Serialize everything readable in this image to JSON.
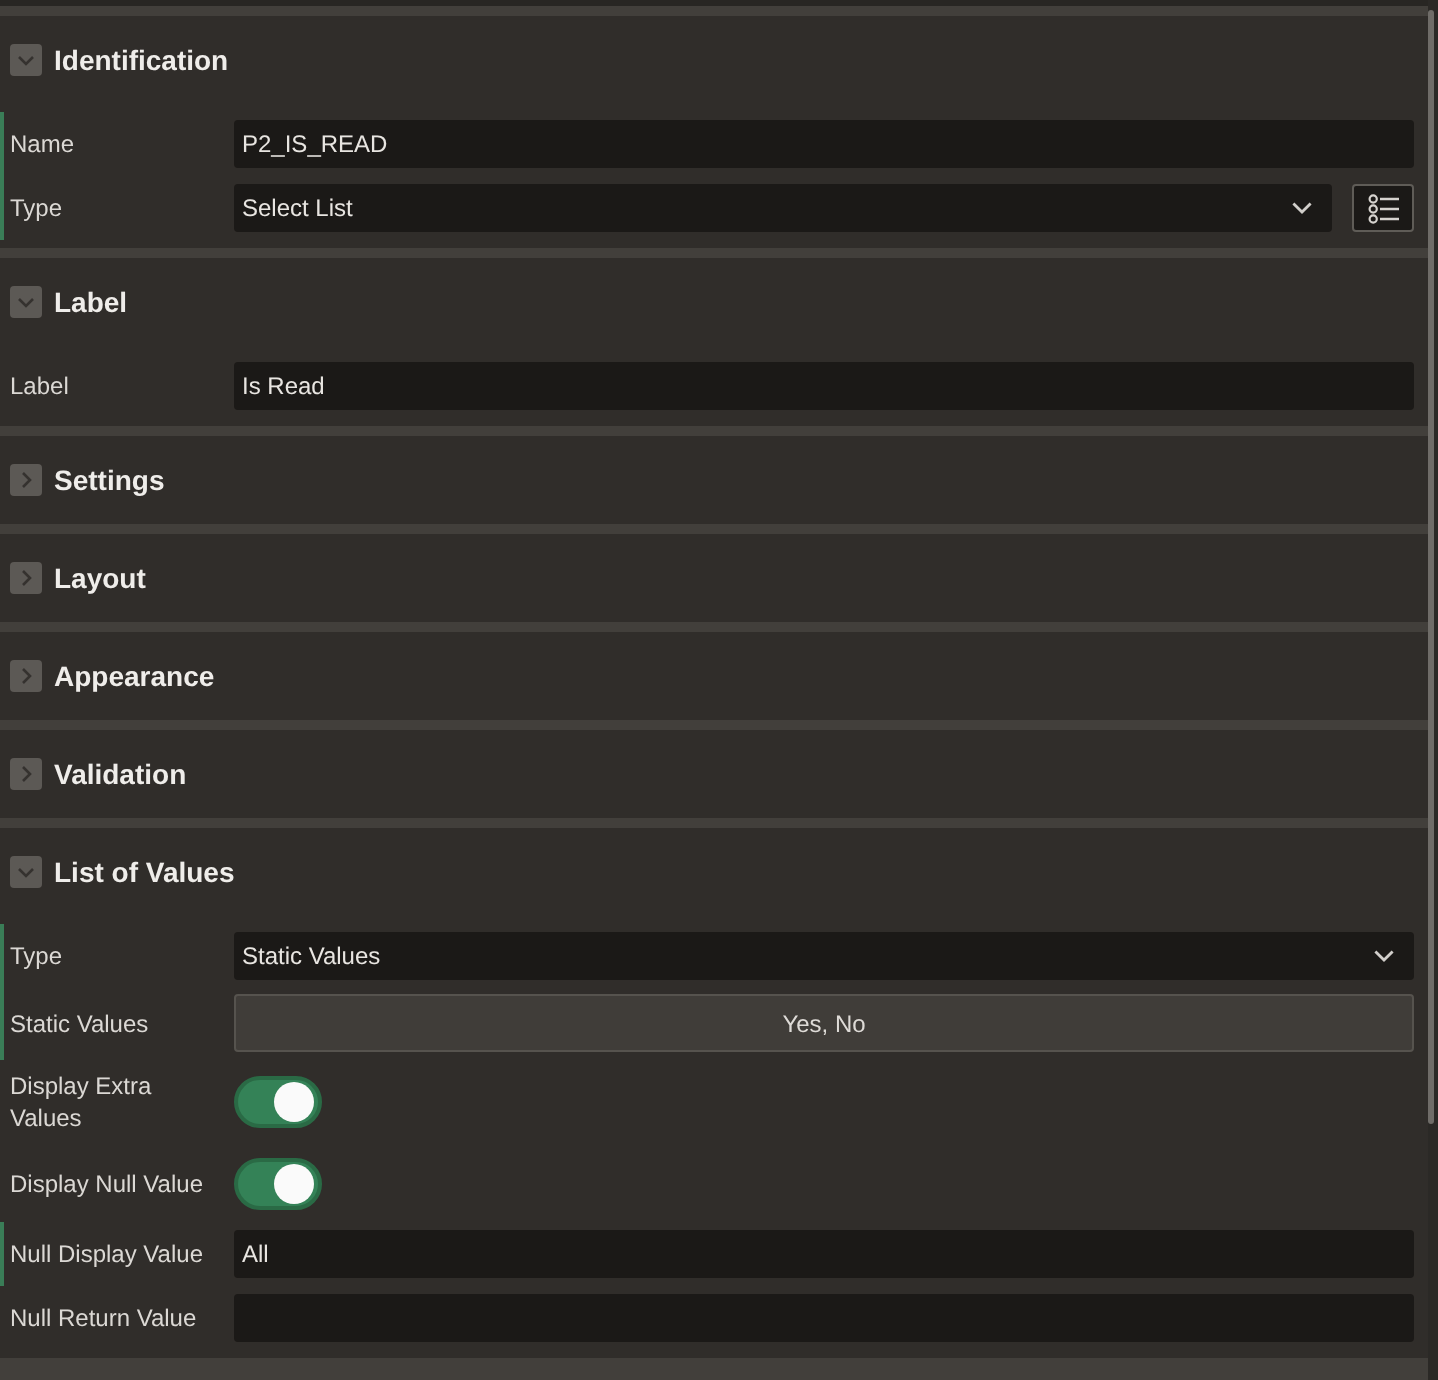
{
  "sections": [
    {
      "title": "Identification",
      "expanded": true,
      "rows": [
        {
          "kind": "text",
          "label": "Name",
          "required": true,
          "value": "P2_IS_READ"
        },
        {
          "kind": "select",
          "label": "Type",
          "required": true,
          "value": "Select List",
          "picker": true
        }
      ]
    },
    {
      "title": "Label",
      "expanded": true,
      "rows": [
        {
          "kind": "text",
          "label": "Label",
          "required": false,
          "value": "Is Read"
        }
      ]
    },
    {
      "title": "Settings",
      "expanded": false
    },
    {
      "title": "Layout",
      "expanded": false
    },
    {
      "title": "Appearance",
      "expanded": false
    },
    {
      "title": "Validation",
      "expanded": false
    },
    {
      "title": "List of Values",
      "expanded": true,
      "rows": [
        {
          "kind": "select",
          "label": "Type",
          "required": true,
          "value": "Static Values",
          "picker": false
        },
        {
          "kind": "button",
          "label": "Static Values",
          "required": true,
          "value": "Yes, No"
        },
        {
          "kind": "switch",
          "label": "Display Extra Values",
          "required": false,
          "on": true
        },
        {
          "kind": "switch",
          "label": "Display Null Value",
          "required": false,
          "on": true
        },
        {
          "kind": "text",
          "label": "Null Display Value",
          "required": true,
          "value": "All"
        },
        {
          "kind": "text",
          "label": "Null Return Value",
          "required": false
        }
      ]
    }
  ]
}
